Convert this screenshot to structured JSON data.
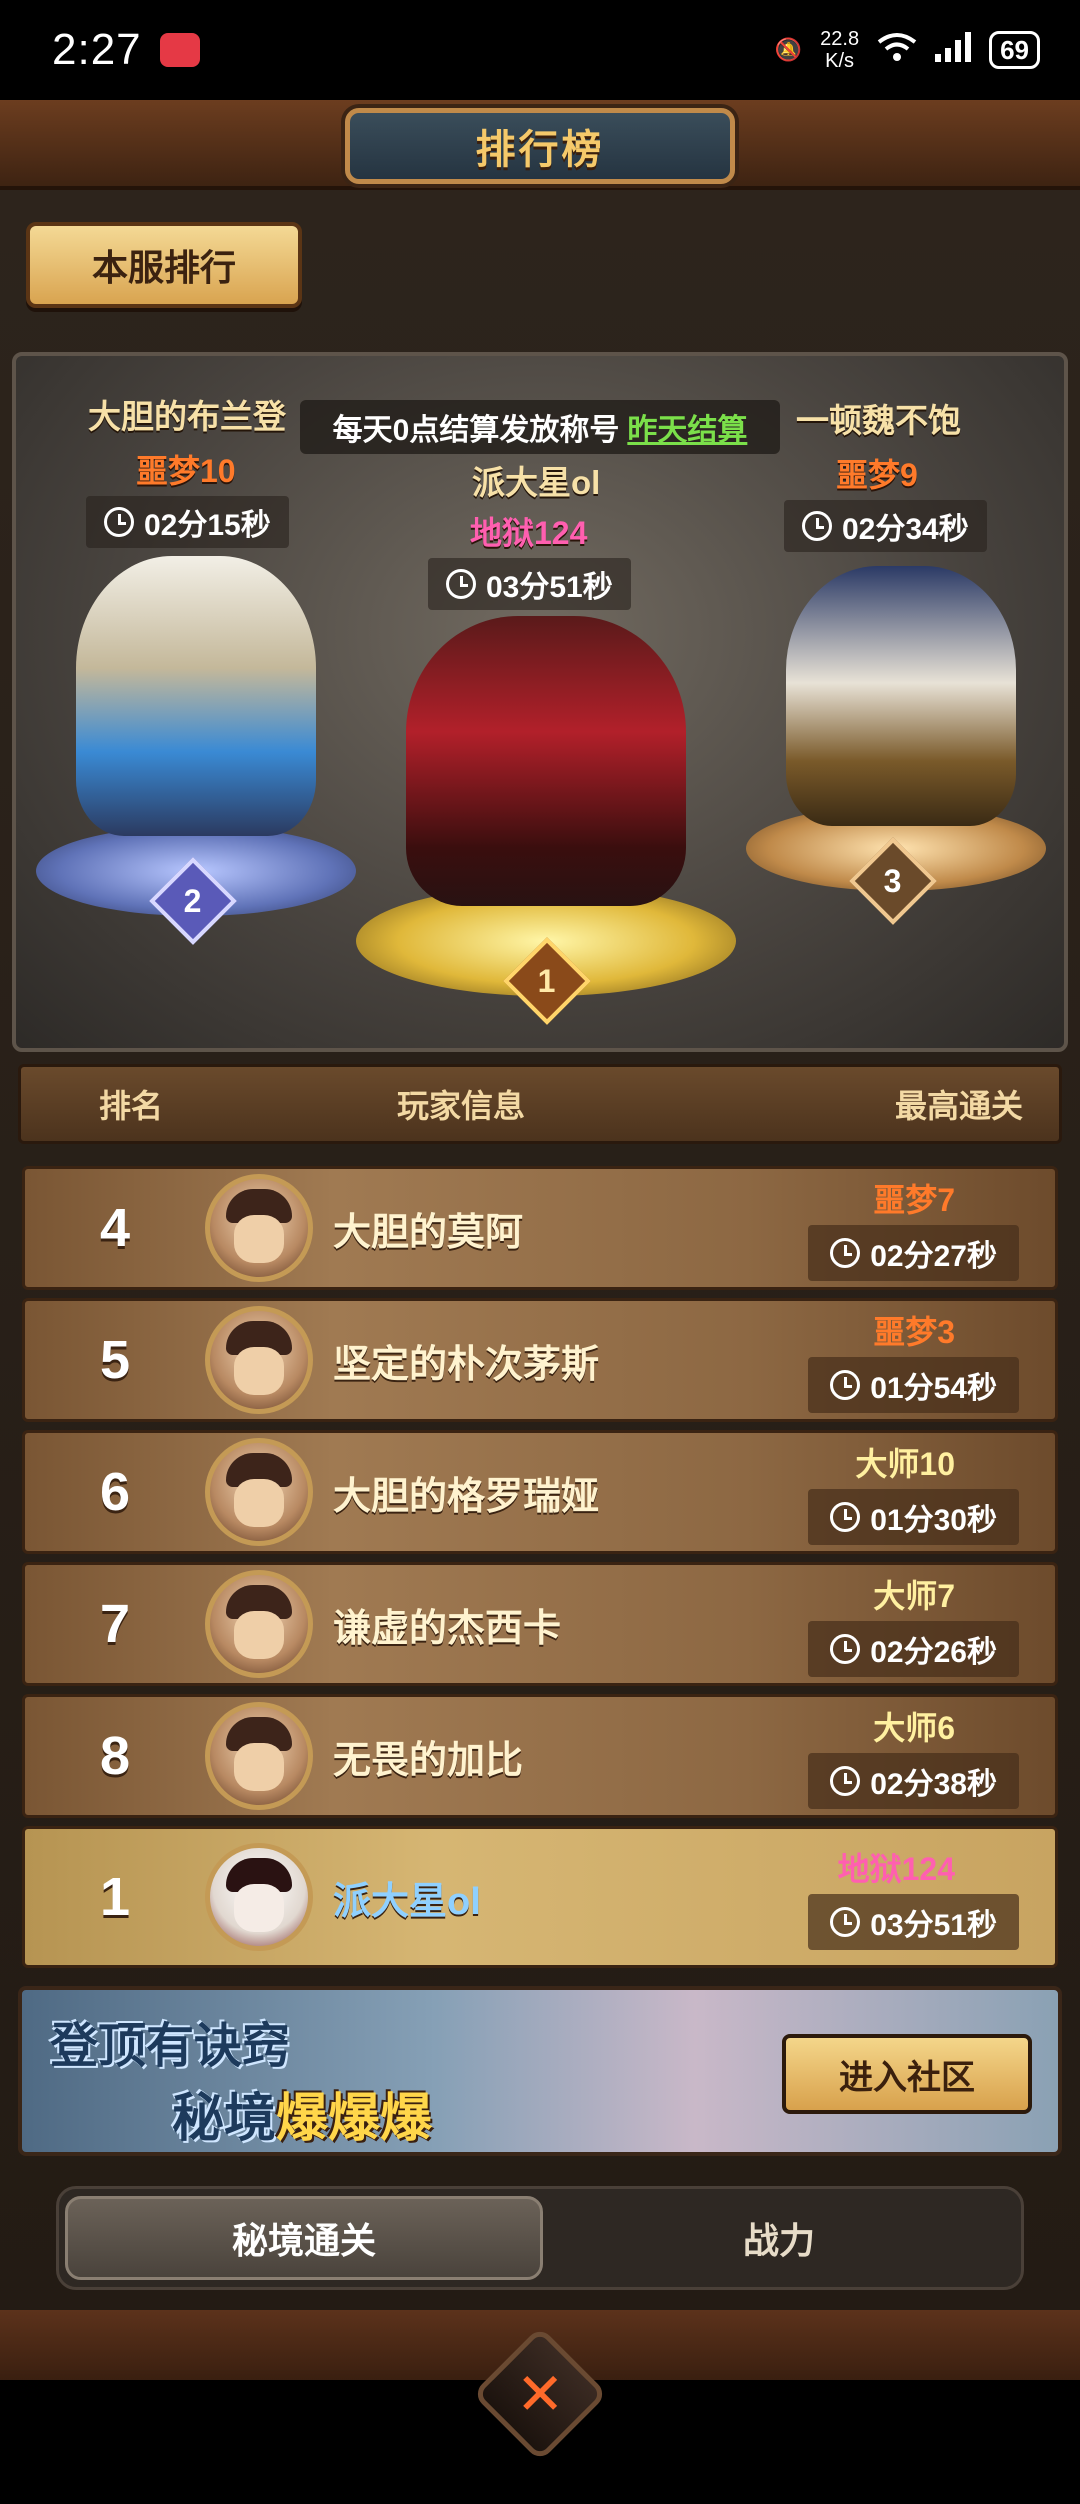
{
  "status_bar": {
    "time": "2:27",
    "speed_value": "22.8",
    "speed_unit": "K/s",
    "battery": "69"
  },
  "header": {
    "title": "排行榜",
    "server_rank_label": "本服排行"
  },
  "notice": {
    "text": "每天0点结算发放称号",
    "link": "昨天结算"
  },
  "podium": {
    "first": {
      "name": "派大星ol",
      "level": "地狱124",
      "time": "03分51秒",
      "rank": "1"
    },
    "second": {
      "name": "大胆的布兰登",
      "level": "噩梦10",
      "time": "02分15秒",
      "rank": "2"
    },
    "third": {
      "name": "一顿魏不饱",
      "level": "噩梦9",
      "time": "02分34秒",
      "rank": "3"
    }
  },
  "list_header": {
    "rank": "排名",
    "player": "玩家信息",
    "best": "最高通关"
  },
  "rows": [
    {
      "rank": "4",
      "name": "大胆的莫阿",
      "level": "噩梦7",
      "time": "02分27秒"
    },
    {
      "rank": "5",
      "name": "坚定的朴次茅斯",
      "level": "噩梦3",
      "time": "01分54秒"
    },
    {
      "rank": "6",
      "name": "大胆的格罗瑞娅",
      "level": "大师10",
      "time": "01分30秒"
    },
    {
      "rank": "7",
      "name": "谦虚的杰西卡",
      "level": "大师7",
      "time": "02分26秒"
    },
    {
      "rank": "8",
      "name": "无畏的加比",
      "level": "大师6",
      "time": "02分38秒"
    }
  ],
  "my_row": {
    "rank": "1",
    "name": "派大星ol",
    "level": "地狱124",
    "time": "03分51秒"
  },
  "community": {
    "line1": "登顶有诀窍",
    "line2_prefix": "秘境",
    "line2_hot": "爆爆爆",
    "button": "进入社区"
  },
  "tabs": [
    {
      "label": "秘境通关",
      "active": true
    },
    {
      "label": "战力",
      "active": false
    }
  ],
  "close_label": "✕",
  "colors": {
    "nightmare": "#ff7a2a",
    "master": "#fff0a0",
    "hell": "#ff5fb0"
  }
}
